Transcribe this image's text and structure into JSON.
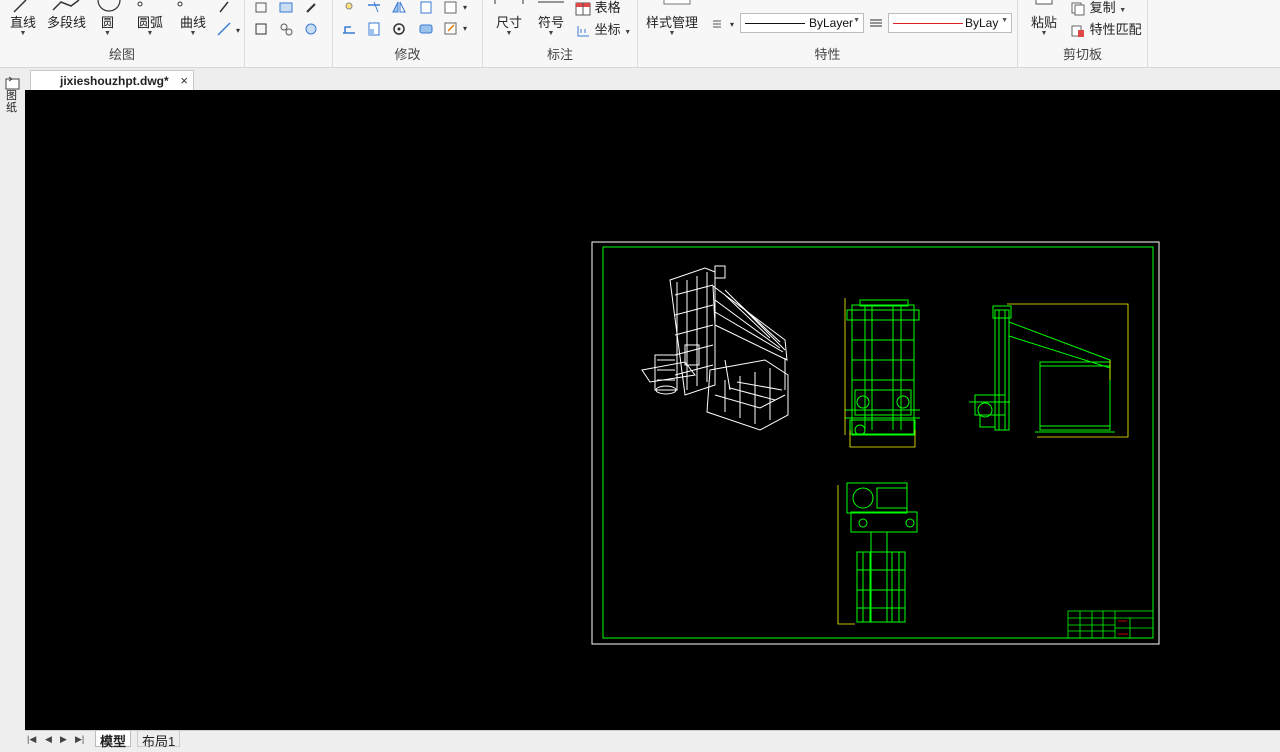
{
  "ribbon": {
    "draw": {
      "title": "绘图",
      "line": "直线",
      "polyline": "多段线",
      "circle": "圆",
      "arc": "圆弧",
      "curve": "曲线"
    },
    "modify": {
      "title": "修改"
    },
    "annotate": {
      "title": "标注",
      "dimension": "尺寸",
      "symbol": "符号",
      "table": "表格",
      "coordinate": "坐标"
    },
    "properties": {
      "title": "特性",
      "style_manager": "样式管理",
      "linetype_value": "ByLayer",
      "lineweight_value": "ByLay"
    },
    "clipboard": {
      "title": "剪切板",
      "paste": "粘贴",
      "copy": "复制",
      "match_properties": "特性匹配"
    }
  },
  "side_panel": {
    "label": "图纸"
  },
  "document_tab": {
    "title": "jixieshouzhpt.dwg*",
    "close": "×"
  },
  "layout_tabs": {
    "model": "模型",
    "layout1": "布局1"
  },
  "colors": {
    "canvas": "#000000",
    "border": "#ffffff",
    "frame": "#00ff00",
    "accent": "#ff0000",
    "dim": "#ffff00"
  }
}
